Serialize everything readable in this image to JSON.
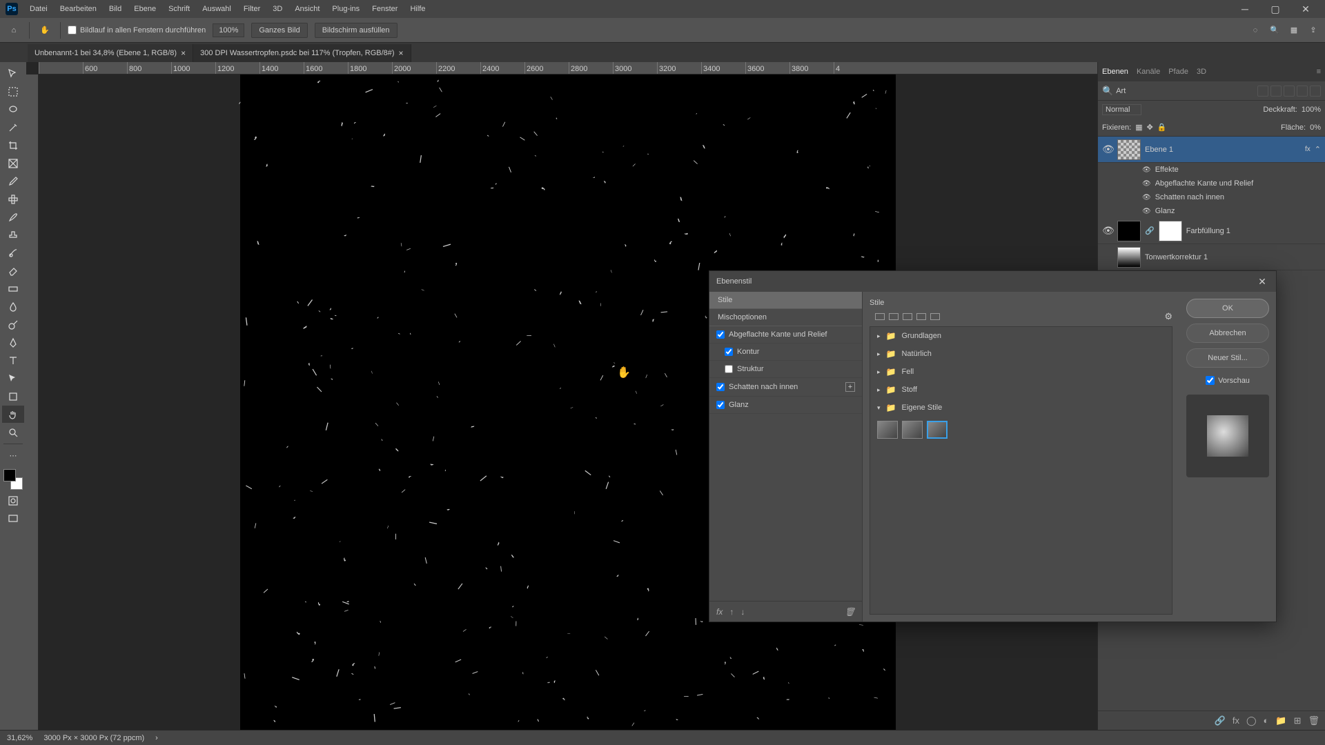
{
  "app": {
    "logo": "Ps"
  },
  "menu": [
    "Datei",
    "Bearbeiten",
    "Bild",
    "Ebene",
    "Schrift",
    "Auswahl",
    "Filter",
    "3D",
    "Ansicht",
    "Plug-ins",
    "Fenster",
    "Hilfe"
  ],
  "options": {
    "scroll_all": "Bildlauf in allen Fenstern durchführen",
    "zoom": "100%",
    "fit": "Ganzes Bild",
    "fill": "Bildschirm ausfüllen"
  },
  "tabs": [
    {
      "label": "Unbenannt-1 bei 34,8% (Ebene 1, RGB/8)",
      "active": true
    },
    {
      "label": "300 DPI Wassertropfen.psdc bei 117% (Tropfen, RGB/8#)",
      "active": false
    }
  ],
  "ruler": [
    "",
    "600",
    "800",
    "1000",
    "1200",
    "1400",
    "1600",
    "1800",
    "2000",
    "2200",
    "2400",
    "2600",
    "2800",
    "3000",
    "3200",
    "3400",
    "3600",
    "3800",
    "4"
  ],
  "panel": {
    "tabs": [
      "Ebenen",
      "Kanäle",
      "Pfade",
      "3D"
    ],
    "filter_kind": "Art",
    "blend": {
      "mode": "Normal",
      "opacity_label": "Deckkraft:",
      "opacity": "100%"
    },
    "lock": {
      "label": "Fixieren:",
      "fill_label": "Fläche:",
      "fill": "0%"
    },
    "layers": {
      "l1": {
        "name": "Ebene 1",
        "fx": "fx"
      },
      "effects_label": "Effekte",
      "fx1": "Abgeflachte Kante und Relief",
      "fx2": "Schatten nach innen",
      "fx3": "Glanz",
      "l2": {
        "name": "Farbfüllung 1"
      },
      "l3": {
        "name": "Tonwertkorrektur 1"
      }
    }
  },
  "status": {
    "zoom": "31,62%",
    "info": "3000 Px × 3000 Px (72 ppcm)"
  },
  "dialog": {
    "title": "Ebenenstil",
    "side": {
      "styles": "Stile",
      "blend": "Mischoptionen",
      "bevel": "Abgeflachte Kante und Relief",
      "contour": "Kontur",
      "texture": "Struktur",
      "inner": "Schatten nach innen",
      "satin": "Glanz"
    },
    "mid": {
      "header": "Stile",
      "cats": [
        "Grundlagen",
        "Natürlich",
        "Fell",
        "Stoff",
        "Eigene Stile"
      ]
    },
    "buttons": {
      "ok": "OK",
      "cancel": "Abbrechen",
      "new": "Neuer Stil...",
      "preview": "Vorschau"
    }
  }
}
